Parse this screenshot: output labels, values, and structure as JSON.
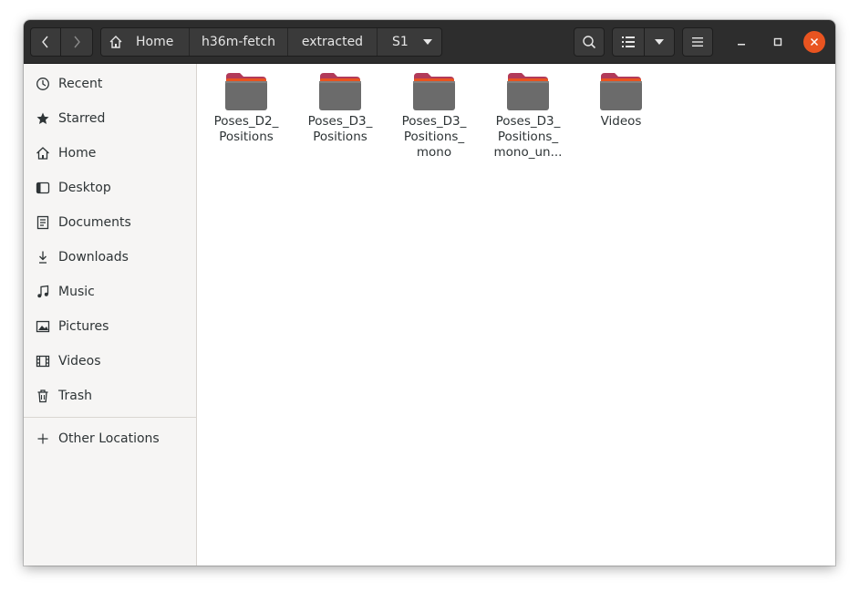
{
  "headerbar": {
    "breadcrumbs": [
      "Home",
      "h36m-fetch",
      "extracted",
      "S1"
    ],
    "icons": {
      "back": "chevron-left-icon",
      "forward": "chevron-right-icon",
      "home": "home-icon",
      "path_menu": "triangle-down-icon",
      "search": "search-icon",
      "list_view": "list-view-icon",
      "view_options": "triangle-down-icon",
      "menu": "hamburger-menu-icon",
      "minimize": "minimize-icon",
      "maximize": "maximize-icon",
      "close": "close-icon"
    },
    "accent_color": "#e95420"
  },
  "sidebar": {
    "items": [
      {
        "label": "Recent",
        "icon": "clock-icon"
      },
      {
        "label": "Starred",
        "icon": "star-icon"
      },
      {
        "label": "Home",
        "icon": "home-icon"
      },
      {
        "label": "Desktop",
        "icon": "desktop-icon"
      },
      {
        "label": "Documents",
        "icon": "document-icon"
      },
      {
        "label": "Downloads",
        "icon": "download-icon"
      },
      {
        "label": "Music",
        "icon": "music-icon"
      },
      {
        "label": "Pictures",
        "icon": "picture-icon"
      },
      {
        "label": "Videos",
        "icon": "film-icon"
      },
      {
        "label": "Trash",
        "icon": "trash-icon"
      }
    ],
    "other_locations": {
      "label": "Other Locations",
      "icon": "plus-icon"
    }
  },
  "folders": [
    {
      "line1": "Poses_D2_",
      "line2": "Positions",
      "line3": ""
    },
    {
      "line1": "Poses_D3_",
      "line2": "Positions",
      "line3": ""
    },
    {
      "line1": "Poses_D3_",
      "line2": "Positions_",
      "line3": "mono"
    },
    {
      "line1": "Poses_D3_",
      "line2": "Positions_",
      "line3": "mono_un..."
    },
    {
      "line1": "Videos",
      "line2": "",
      "line3": ""
    }
  ]
}
